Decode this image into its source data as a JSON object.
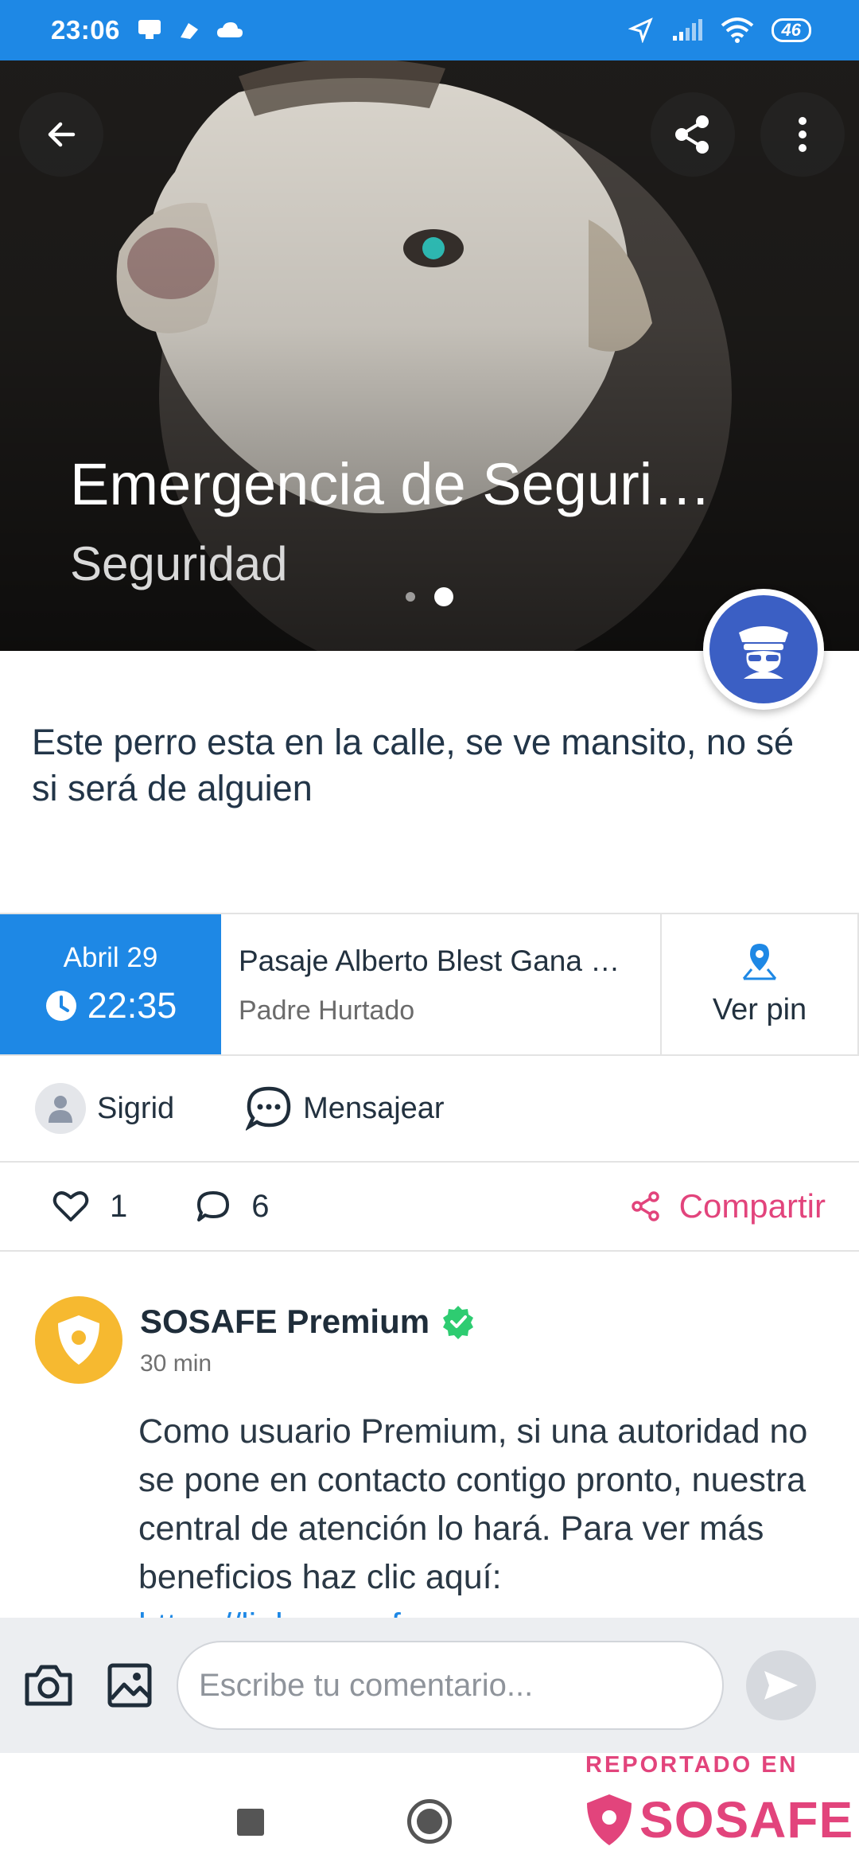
{
  "status_bar": {
    "time": "23:06",
    "battery": "46"
  },
  "hero": {
    "title": "Emergencia de Seguri…",
    "subtitle": "Seguridad",
    "slides": 2,
    "active_slide": 2
  },
  "description": "Este perro esta en la calle, se ve mansito, no sé si será de alguien",
  "info": {
    "date": "Abril 29",
    "time": "22:35",
    "address": "Pasaje Alberto Blest Gana  …",
    "commune": "Padre Hurtado",
    "pin_label": "Ver pin"
  },
  "user": {
    "name": "Sigrid",
    "message_label": "Mensajear"
  },
  "actions": {
    "likes": "1",
    "comments": "6",
    "share_label": "Compartir"
  },
  "comment": {
    "author": "SOSAFE Premium",
    "time": "30 min",
    "text": "Como usuario Premium, si una autoridad no se pone en contacto contigo pronto, nuestra central de atención lo hará. Para ver más beneficios haz clic aquí: ",
    "link": "https://links.sosafeapp.com"
  },
  "input": {
    "placeholder": "Escribe tu comentario..."
  },
  "watermark": {
    "top": "REPORTADO EN",
    "brand": "SOSAFE"
  },
  "colors": {
    "primary": "#1e88e5",
    "accent": "#e2447c",
    "badge": "#3b5fc4",
    "premium": "#f6b930",
    "verified": "#2ecc71"
  }
}
